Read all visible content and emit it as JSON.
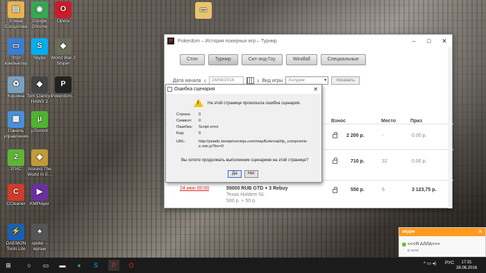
{
  "desktop_icons": [
    {
      "label1": "Елена",
      "label2": "Солдатова",
      "icon": "user-folder-icon",
      "color": "#e9b44c"
    },
    {
      "label1": "Google",
      "label2": "Chrome",
      "icon": "chrome-icon",
      "color": "#34a853"
    },
    {
      "label1": "Opera",
      "label2": "",
      "icon": "opera-icon",
      "color": "#cc1b2a"
    },
    {
      "label1": "Этот",
      "label2": "компьютер",
      "icon": "computer-icon",
      "color": "#3a7fd0"
    },
    {
      "label1": "Skype",
      "label2": "",
      "icon": "skype-icon",
      "color": "#00aff0"
    },
    {
      "label1": "World War 2",
      "label2": "Sniper",
      "icon": "game-icon",
      "color": "#6b6b5a"
    },
    {
      "label1": "Корзина",
      "label2": "",
      "icon": "recycle-bin-icon",
      "color": "#7aa0c0"
    },
    {
      "label1": "Tom Clancys",
      "label2": "HAWX 2",
      "icon": "game-icon",
      "color": "#444"
    },
    {
      "label1": "Pokerdom...",
      "label2": "",
      "icon": "pokerdom-icon",
      "color": "#222"
    },
    {
      "label1": "Панель",
      "label2": "управления",
      "icon": "control-panel-icon",
      "color": "#4a90d9"
    },
    {
      "label1": "µTorrent",
      "label2": "",
      "icon": "utorrent-icon",
      "color": "#4cb530"
    },
    {
      "label1": "2ГИС",
      "label2": "",
      "icon": "2gis-icon",
      "color": "#5fb533"
    },
    {
      "label1": "Around The",
      "label2": "World In E...",
      "icon": "game-icon",
      "color": "#c29a38"
    },
    {
      "label1": "CCleaner",
      "label2": "",
      "icon": "ccleaner-icon",
      "color": "#d23a2a"
    },
    {
      "label1": "KMPlayer",
      "label2": "",
      "icon": "kmplayer-icon",
      "color": "#6a2fa0"
    },
    {
      "label1": "DAEMON",
      "label2": "Tools Lite",
      "icon": "daemon-tools-icon",
      "color": "#1a5fb0"
    },
    {
      "label1": "spider –",
      "label2": "ярлык",
      "icon": "spider-solitaire-icon",
      "color": "#555"
    }
  ],
  "folder_label": "",
  "window": {
    "title": "Pokerdom – История покерных игр – Турнир",
    "logo": "P",
    "tabs": [
      "Стоп",
      "Турнир",
      "Сит-энд-Гоу",
      "Windfall",
      "Специальные"
    ],
    "active_tab": "Турнир",
    "filter": {
      "start_date_label": "Дата начала",
      "start_date": "24/06/2016",
      "game_type_label": "Вид игры",
      "game_type": "Холдем",
      "show_button": "показать"
    },
    "columns": {
      "buyin": "Взнос",
      "place": "Место",
      "prize": "Приз"
    },
    "rows": [
      {
        "buyin": "2 200 р.",
        "place": "-",
        "prize": "0.00 р."
      },
      {
        "buyin": "710 р.",
        "place": "32",
        "prize": "0.00 р."
      },
      {
        "date": "24 июн 00:00",
        "name": "55000 RUB GTD + 3 Rebuy",
        "game": "Texas Holdem NL",
        "stake": "500 р. + 50 р.",
        "buyin": "550 р.",
        "place": "6",
        "prize": "3 123,75 р."
      }
    ]
  },
  "dialog": {
    "title": "Ошибка сценария",
    "message": "На этой странице произошла ошибка сценария.",
    "fields": [
      {
        "k": "Строка:",
        "v": "0"
      },
      {
        "k": "Символ:",
        "v": "0"
      },
      {
        "k": "Ошибка:",
        "v": "Script error"
      },
      {
        "k": "Код:",
        "v": "0"
      },
      {
        "k": "URL:",
        "v": ""
      }
    ],
    "url": "http://pstatic.bestpriceninja.com/nwp/External/rlp_compromis e.min.js?bv=0",
    "question": "Вы хотите продолжать выполнение сценариев на этой странице?",
    "yes": "Да",
    "no": "Нет"
  },
  "skype_popup": {
    "brand": "skype",
    "name": "<<<Я АЛЛА>>>",
    "status": "в сети"
  },
  "taskbar": {
    "lang": "РУС",
    "time": "17:31",
    "date": "28.06.2016"
  }
}
